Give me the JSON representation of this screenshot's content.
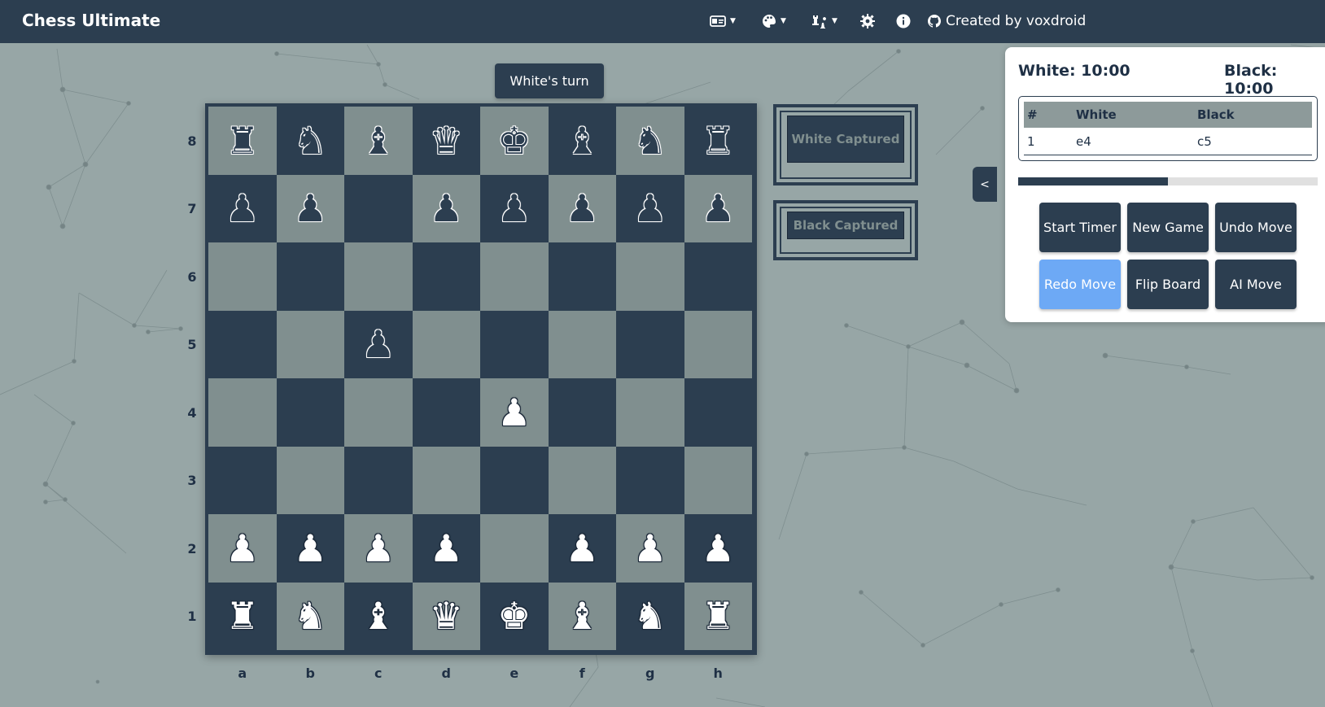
{
  "app": {
    "title": "Chess Ultimate",
    "credit": "Created by voxdroid"
  },
  "nav": [
    {
      "icon": "language-icon",
      "dropdown": true
    },
    {
      "icon": "palette-icon",
      "dropdown": true
    },
    {
      "icon": "chess-pieces-icon",
      "dropdown": true
    },
    {
      "icon": "gear-icon",
      "dropdown": false
    },
    {
      "icon": "info-icon",
      "dropdown": false
    },
    {
      "icon": "github-icon",
      "dropdown": false
    }
  ],
  "turn": "White's turn",
  "board": {
    "ranks": [
      "8",
      "7",
      "6",
      "5",
      "4",
      "3",
      "2",
      "1"
    ],
    "files": [
      "a",
      "b",
      "c",
      "d",
      "e",
      "f",
      "g",
      "h"
    ],
    "rows": [
      [
        "bR",
        "bN",
        "bB",
        "bQ",
        "bK",
        "bB",
        "bN",
        "bR"
      ],
      [
        "bP",
        "bP",
        "",
        "bP",
        "bP",
        "bP",
        "bP",
        "bP"
      ],
      [
        "",
        "",
        "",
        "",
        "",
        "",
        "",
        ""
      ],
      [
        "",
        "",
        "bP",
        "",
        "",
        "",
        "",
        ""
      ],
      [
        "",
        "",
        "",
        "",
        "wP",
        "",
        "",
        ""
      ],
      [
        "",
        "",
        "",
        "",
        "",
        "",
        "",
        ""
      ],
      [
        "wP",
        "wP",
        "wP",
        "wP",
        "",
        "wP",
        "wP",
        "wP"
      ],
      [
        "wR",
        "wN",
        "wB",
        "wQ",
        "wK",
        "wB",
        "wN",
        "wR"
      ]
    ]
  },
  "captured": {
    "white_title": "White Captured",
    "black_title": "Black Captured"
  },
  "clocks": {
    "white": "White: 10:00",
    "black": "Black: 10:00",
    "time_remaining_fraction": 0.5
  },
  "moves": {
    "headers": [
      "#",
      "White",
      "Black"
    ],
    "rows": [
      {
        "num": "1",
        "white": "e4",
        "black": "c5"
      }
    ]
  },
  "buttons": {
    "start_timer": "Start Timer",
    "new_game": "New Game",
    "undo_move": "Undo Move",
    "redo_move": "Redo Move",
    "flip_board": "Flip Board",
    "ai_move": "AI Move"
  },
  "colors": {
    "dark_square": "#2c3e50",
    "light_square": "#808f8f",
    "accent": "#6da9f5",
    "background": "#97a6a6"
  }
}
